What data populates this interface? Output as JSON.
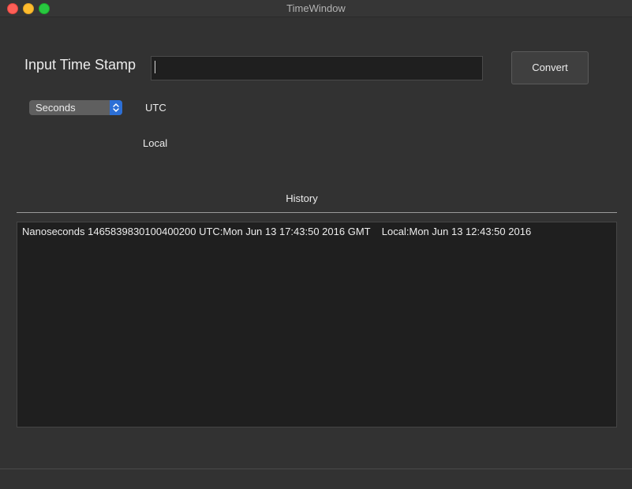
{
  "window": {
    "title": "TimeWindow"
  },
  "form": {
    "input_label": "Input Time Stamp",
    "input_value": "",
    "convert_label": "Convert",
    "unit_selected": "Seconds",
    "utc_label": "UTC",
    "local_label": "Local"
  },
  "history": {
    "label": "History",
    "entries": [
      "Nanoseconds 1465839830100400200 UTC:Mon Jun 13 17:43:50 2016 GMT    Local:Mon Jun 13 12:43:50 2016"
    ]
  },
  "icons": {
    "close": "close-icon",
    "minimize": "minimize-icon",
    "zoom": "zoom-icon",
    "select_arrows": "chevron-up-down-icon"
  },
  "colors": {
    "window_bg": "#323232",
    "field_bg": "#1f1f1f",
    "accent": "#2c6fd6",
    "close": "#fe5f57",
    "minimize": "#febc2e",
    "zoom": "#28c840"
  }
}
